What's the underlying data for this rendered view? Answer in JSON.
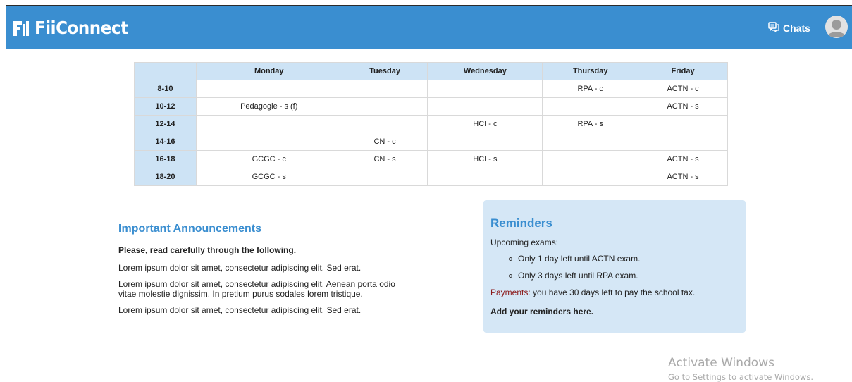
{
  "header": {
    "brand": "FiiConnect",
    "chats_label": "Chats",
    "background": "#3a8ed0"
  },
  "schedule": {
    "headers": [
      "",
      "Monday",
      "Tuesday",
      "Wednesday",
      "Thursday",
      "Friday"
    ],
    "rows": [
      {
        "time": "8-10",
        "cells": [
          "",
          "",
          "",
          "RPA - c",
          "ACTN - c"
        ]
      },
      {
        "time": "10-12",
        "cells": [
          "Pedagogie - s (f)",
          "",
          "",
          "",
          "ACTN - s"
        ]
      },
      {
        "time": "12-14",
        "cells": [
          "",
          "",
          "HCI - c",
          "RPA - s",
          ""
        ]
      },
      {
        "time": "14-16",
        "cells": [
          "",
          "CN - c",
          "",
          "",
          ""
        ]
      },
      {
        "time": "16-18",
        "cells": [
          "GCGC - c",
          "CN - s",
          "HCI - s",
          "",
          "ACTN - s"
        ]
      },
      {
        "time": "18-20",
        "cells": [
          "GCGC - s",
          "",
          "",
          "",
          "ACTN - s"
        ]
      }
    ]
  },
  "announcements": {
    "title": "Important Announcements",
    "lead": "Please, read carefully through the following.",
    "paragraphs": [
      "Lorem ipsum dolor sit amet, consectetur adipiscing elit. Sed erat.",
      "Lorem ipsum dolor sit amet, consectetur adipiscing elit. Aenean porta odio vitae molestie dignissim. In pretium purus sodales lorem tristique.",
      "Lorem ipsum dolor sit amet, consectetur adipiscing elit. Sed erat."
    ]
  },
  "reminders": {
    "title": "Reminders",
    "subtitle": "Upcoming exams:",
    "items": [
      "Only 1 day left until ACTN exam.",
      "Only 3 days left until RPA exam."
    ],
    "payments_label": "Payments:",
    "payments_text": " you have 30 days left to pay the school tax.",
    "add_text": "Add your reminders here."
  },
  "watermark": {
    "line1": "Activate Windows",
    "line2": "Go to Settings to activate Windows."
  },
  "icons": {
    "logo": "fii-logo-icon",
    "chats": "chat-bubbles-icon",
    "avatar": "user-avatar-icon"
  }
}
